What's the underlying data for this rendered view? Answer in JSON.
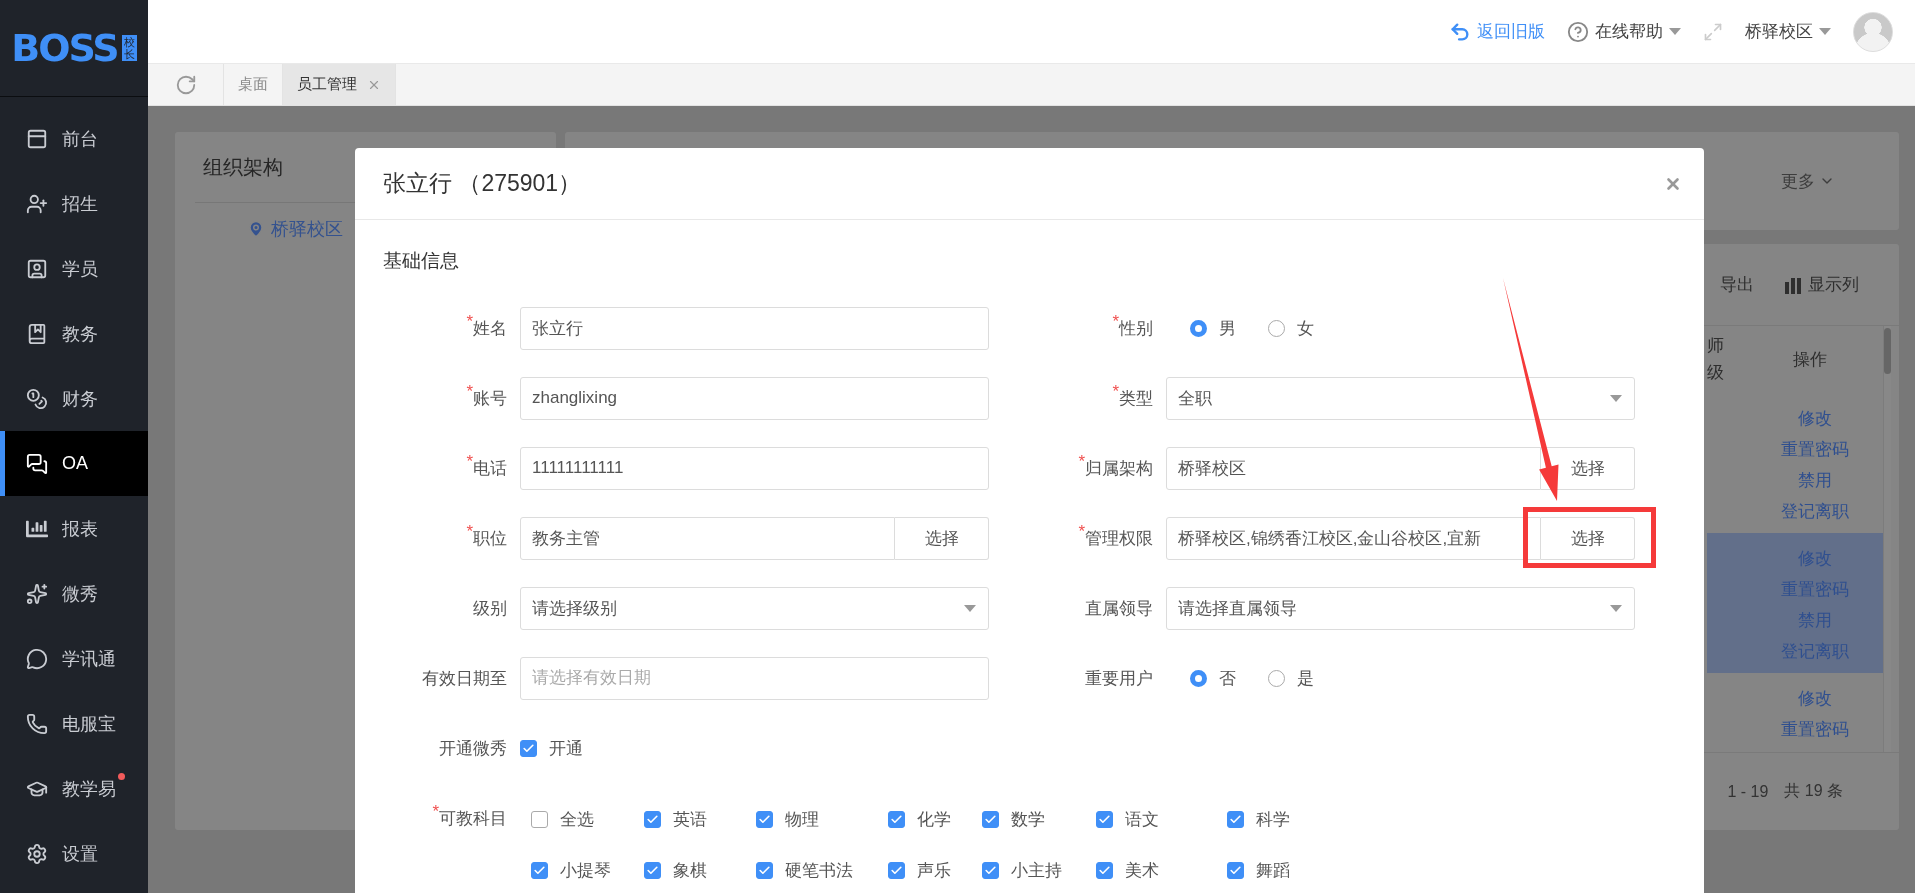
{
  "sidebar": {
    "logo": {
      "text": "BOSS",
      "badge": "校长"
    },
    "items": [
      {
        "label": "前台",
        "selected": false,
        "notification": false
      },
      {
        "label": "招生",
        "selected": false,
        "notification": false
      },
      {
        "label": "学员",
        "selected": false,
        "notification": false
      },
      {
        "label": "教务",
        "selected": false,
        "notification": false
      },
      {
        "label": "财务",
        "selected": false,
        "notification": false
      },
      {
        "label": "OA",
        "selected": true,
        "notification": false
      },
      {
        "label": "报表",
        "selected": false,
        "notification": false
      },
      {
        "label": "微秀",
        "selected": false,
        "notification": false
      },
      {
        "label": "学讯通",
        "selected": false,
        "notification": false
      },
      {
        "label": "电服宝",
        "selected": false,
        "notification": false
      },
      {
        "label": "教学易",
        "selected": false,
        "notification": true
      },
      {
        "label": "设置",
        "selected": false,
        "notification": false
      }
    ]
  },
  "top_bar": {
    "back_link": "返回旧版",
    "help": "在线帮助",
    "campus": "桥驿校区"
  },
  "tabs": [
    {
      "label": "桌面",
      "selected": false,
      "closable": false
    },
    {
      "label": "员工管理",
      "selected": true,
      "closable": true
    }
  ],
  "background": {
    "org_panel": {
      "title": "组织架构",
      "tree": [
        {
          "label": "桥驿校区"
        }
      ]
    },
    "filter_bar": {
      "more": "更多"
    },
    "toolbar": [
      {
        "kind": "export",
        "label": "导出"
      },
      {
        "kind": "columns",
        "label": "显示列"
      }
    ],
    "table": {
      "columns": [
        "师级",
        "操作"
      ],
      "rows": [
        {
          "selected": false,
          "actions": [
            "修改",
            "重置密码",
            "禁用",
            "登记离职"
          ]
        },
        {
          "selected": true,
          "actions": [
            "修改",
            "重置密码",
            "禁用",
            "登记离职"
          ]
        },
        {
          "selected": false,
          "actions": [
            "修改",
            "重置密码"
          ]
        }
      ]
    },
    "pagination": {
      "range": "1 - 19",
      "total": "共 19 条"
    }
  },
  "dialog": {
    "title": "张立行 （275901）",
    "section": "基础信息",
    "rows": [
      {
        "left": {
          "kind": "text",
          "mark": "*",
          "label": "姓名",
          "value": "张立行"
        },
        "right": {
          "kind": "radio",
          "mark": "*",
          "label": "性别",
          "options": [
            {
              "label": "男",
              "selected": true
            },
            {
              "label": "女",
              "selected": false
            }
          ]
        }
      },
      {
        "left": {
          "kind": "text",
          "mark": "*",
          "label": "账号",
          "value": "zhanglixing"
        },
        "right": {
          "kind": "select",
          "mark": "*",
          "label": "类型",
          "value": "全职"
        }
      },
      {
        "left": {
          "kind": "text",
          "mark": "*",
          "label": "电话",
          "value": "11111111111"
        },
        "right": {
          "kind": "picker",
          "mark": "*",
          "label": "归属架构",
          "value": "桥驿校区",
          "button": "选择"
        }
      },
      {
        "left": {
          "kind": "picker",
          "mark": "*",
          "label": "职位",
          "value": "教务主管",
          "button": "选择"
        },
        "right": {
          "kind": "picker",
          "mark": "*",
          "label": "管理权限",
          "value": "桥驿校区,锦绣香江校区,金山谷校区,宜新",
          "button": "选择"
        }
      },
      {
        "left": {
          "kind": "select",
          "label": "级别",
          "value": "请选择级别"
        },
        "right": {
          "kind": "select",
          "label": "直属领导",
          "value": "请选择直属领导"
        }
      },
      {
        "left": {
          "kind": "date",
          "label": "有效日期至",
          "placeholder": "请选择有效日期"
        },
        "right": {
          "kind": "radio",
          "label": "重要用户",
          "options": [
            {
              "label": "否",
              "selected": true
            },
            {
              "label": "是",
              "selected": false
            }
          ]
        }
      }
    ],
    "weixiu": {
      "label": "开通微秀",
      "option": {
        "label": "开通",
        "checked": true
      }
    },
    "subjects": {
      "mark": "*",
      "label": "可教科目",
      "options": [
        {
          "label": "全选",
          "checked": false
        },
        {
          "label": "英语",
          "checked": true
        },
        {
          "label": "物理",
          "checked": true
        },
        {
          "label": "化学",
          "checked": true
        },
        {
          "label": "数学",
          "checked": true
        },
        {
          "label": "语文",
          "checked": true
        },
        {
          "label": "科学",
          "checked": true
        },
        {
          "label": "小提琴",
          "checked": true
        },
        {
          "label": "象棋",
          "checked": true
        },
        {
          "label": "硬笔书法",
          "checked": true
        },
        {
          "label": "声乐",
          "checked": true
        },
        {
          "label": "小主持",
          "checked": true
        },
        {
          "label": "美术",
          "checked": true
        },
        {
          "label": "舞蹈",
          "checked": true
        }
      ]
    }
  }
}
